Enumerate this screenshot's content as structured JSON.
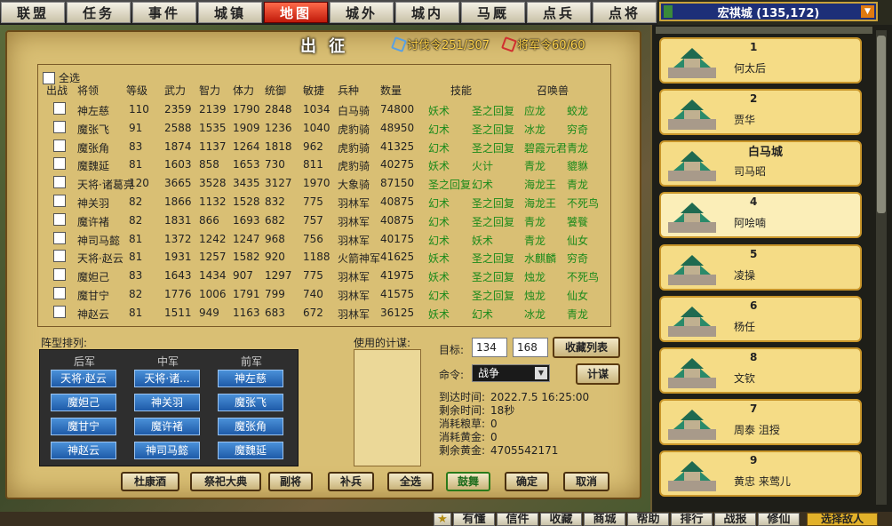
{
  "nav": {
    "tabs": [
      "联盟",
      "任务",
      "事件",
      "城镇",
      "地图",
      "城外",
      "城内",
      "马厩",
      "点兵",
      "点将"
    ],
    "active_index": 4
  },
  "city_bar": {
    "label": "宏祺城 (135,172)"
  },
  "dialog": {
    "title": "出 征",
    "tokens": {
      "attack": "讨伐令251/307",
      "general": "将军令60/60"
    },
    "select_all": "全选",
    "headers": [
      "出战",
      "将领",
      "等级",
      "武力",
      "智力",
      "体力",
      "统御",
      "敏捷",
      "兵种",
      "数量",
      "技能",
      "召唤兽"
    ],
    "generals": [
      {
        "name": "神左慈",
        "level": "110",
        "str": "2359",
        "int": "2139",
        "hp": "1790",
        "lead": "2848",
        "agi": "1034",
        "unit": "白马骑",
        "count": "74800",
        "skill1": "妖术",
        "skill2": "圣之回复",
        "beast1": "应龙",
        "beast2": "蛟龙"
      },
      {
        "name": "魔张飞",
        "level": "91",
        "str": "2588",
        "int": "1535",
        "hp": "1909",
        "lead": "1236",
        "agi": "1040",
        "unit": "虎豹骑",
        "count": "48950",
        "skill1": "幻术",
        "skill2": "圣之回复",
        "beast1": "冰龙",
        "beast2": "穷奇"
      },
      {
        "name": "魔张角",
        "level": "83",
        "str": "1874",
        "int": "1137",
        "hp": "1264",
        "lead": "1818",
        "agi": "962",
        "unit": "虎豹骑",
        "count": "41325",
        "skill1": "幻术",
        "skill2": "圣之回复",
        "beast1": "碧霞元君",
        "beast2": "青龙"
      },
      {
        "name": "魔魏延",
        "level": "81",
        "str": "1603",
        "int": "858",
        "hp": "1653",
        "lead": "730",
        "agi": "811",
        "unit": "虎豹骑",
        "count": "40275",
        "skill1": "妖术",
        "skill2": "火计",
        "beast1": "青龙",
        "beast2": "貔貅"
      },
      {
        "name": "天将·诸葛亮",
        "level": "120",
        "str": "3665",
        "int": "3528",
        "hp": "3435",
        "lead": "3127",
        "agi": "1970",
        "unit": "大象骑",
        "count": "87150",
        "skill1": "圣之回复",
        "skill2": "幻术",
        "beast1": "海龙王",
        "beast2": "青龙"
      },
      {
        "name": "神关羽",
        "level": "82",
        "str": "1866",
        "int": "1132",
        "hp": "1528",
        "lead": "832",
        "agi": "775",
        "unit": "羽林军",
        "count": "40875",
        "skill1": "幻术",
        "skill2": "圣之回复",
        "beast1": "海龙王",
        "beast2": "不死鸟"
      },
      {
        "name": "魔许褚",
        "level": "82",
        "str": "1831",
        "int": "866",
        "hp": "1693",
        "lead": "682",
        "agi": "757",
        "unit": "羽林军",
        "count": "40875",
        "skill1": "幻术",
        "skill2": "圣之回复",
        "beast1": "青龙",
        "beast2": "饕餮"
      },
      {
        "name": "神司马懿",
        "level": "81",
        "str": "1372",
        "int": "1242",
        "hp": "1247",
        "lead": "968",
        "agi": "756",
        "unit": "羽林军",
        "count": "40175",
        "skill1": "幻术",
        "skill2": "妖术",
        "beast1": "青龙",
        "beast2": "仙女"
      },
      {
        "name": "天将·赵云",
        "level": "81",
        "str": "1931",
        "int": "1257",
        "hp": "1582",
        "lead": "920",
        "agi": "1188",
        "unit": "火箭神军",
        "count": "41625",
        "skill1": "妖术",
        "skill2": "圣之回复",
        "beast1": "水麒麟",
        "beast2": "穷奇"
      },
      {
        "name": "魔妲己",
        "level": "83",
        "str": "1643",
        "int": "1434",
        "hp": "907",
        "lead": "1297",
        "agi": "775",
        "unit": "羽林军",
        "count": "41975",
        "skill1": "妖术",
        "skill2": "圣之回复",
        "beast1": "烛龙",
        "beast2": "不死鸟"
      },
      {
        "name": "魔甘宁",
        "level": "82",
        "str": "1776",
        "int": "1006",
        "hp": "1791",
        "lead": "799",
        "agi": "740",
        "unit": "羽林军",
        "count": "41575",
        "skill1": "幻术",
        "skill2": "圣之回复",
        "beast1": "烛龙",
        "beast2": "仙女"
      },
      {
        "name": "神赵云",
        "level": "81",
        "str": "1511",
        "int": "949",
        "hp": "1163",
        "lead": "683",
        "agi": "672",
        "unit": "羽林军",
        "count": "36125",
        "skill1": "妖术",
        "skill2": "幻术",
        "beast1": "冰龙",
        "beast2": "青龙"
      }
    ],
    "formation": {
      "label": "阵型排列:",
      "columns": [
        "后军",
        "中军",
        "前军"
      ],
      "rows": [
        [
          "天将·赵云",
          "天将·诸...",
          "神左慈"
        ],
        [
          "魔妲己",
          "神关羽",
          "魔张飞"
        ],
        [
          "魔甘宁",
          "魔许褚",
          "魔张角"
        ],
        [
          "神赵云",
          "神司马懿",
          "魔魏延"
        ]
      ]
    },
    "tactics_label": "使用的计谋:",
    "target": {
      "label": "目标:",
      "x": "134",
      "y": "168",
      "fav_button": "收藏列表"
    },
    "command": {
      "label": "命令:",
      "value": "战争",
      "plan_button": "计谋"
    },
    "info": [
      {
        "label": "到达时间:",
        "value": "2022.7.5  16:25:00"
      },
      {
        "label": "剩余时间:",
        "value": "18秒"
      },
      {
        "label": "消耗粮草:",
        "value": "0"
      },
      {
        "label": "消耗黄金:",
        "value": "0"
      },
      {
        "label": "剩余黄金:",
        "value": "4705542171"
      }
    ],
    "bottom_buttons": [
      "杜康酒",
      "祭祀大典",
      "副将",
      "补兵",
      "全选",
      "鼓舞",
      "确定",
      "取消"
    ]
  },
  "city_list": [
    {
      "num": "1",
      "city": "",
      "name": "何太后"
    },
    {
      "num": "2",
      "city": "",
      "name": "贾华"
    },
    {
      "num": "",
      "city": "白马城",
      "name": "司马昭"
    },
    {
      "num": "4",
      "city": "",
      "name": "阿哙喃"
    },
    {
      "num": "5",
      "city": "",
      "name": "凌操"
    },
    {
      "num": "6",
      "city": "",
      "name": "杨任"
    },
    {
      "num": "8",
      "city": "",
      "name": "文钦"
    },
    {
      "num": "7",
      "city": "",
      "name": "周泰 沮授"
    },
    {
      "num": "9",
      "city": "",
      "name": "黄忠 来莺儿"
    }
  ],
  "bottom_tabs": [
    "有懂",
    "信件",
    "收藏",
    "商城",
    "帮助",
    "排行",
    "战报",
    "修仙"
  ],
  "enemy_button": "选择敌人",
  "colors": {
    "active_tab": "#d0301a",
    "skill_green": "#1a8a1a",
    "city_bar_bg": "#1d2f78",
    "formation_btn": "#2e6fc0"
  }
}
